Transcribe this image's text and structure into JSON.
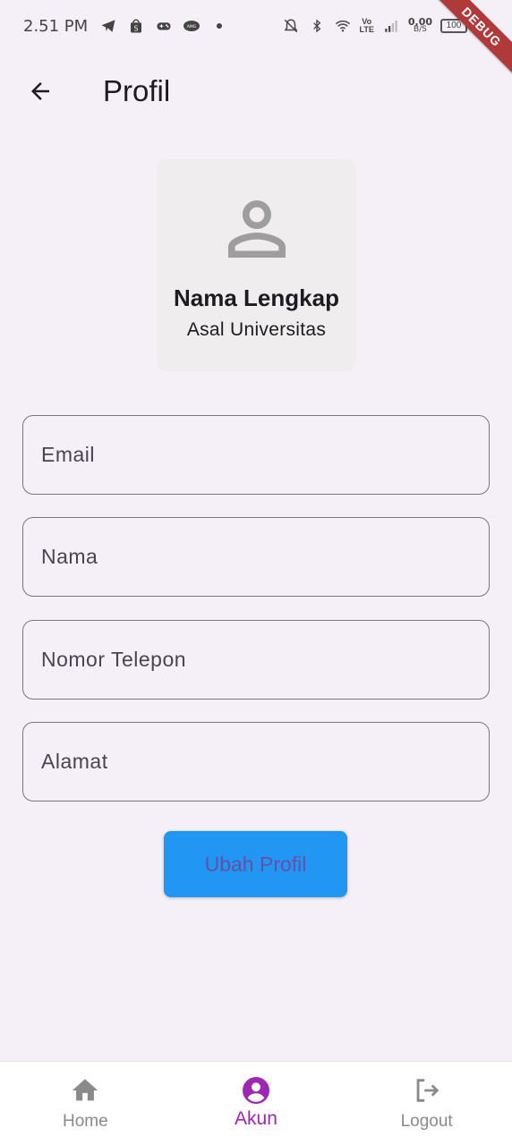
{
  "status_bar": {
    "time": "2.51 PM",
    "net_speed_value": "0,00",
    "net_speed_unit": "B/S",
    "lte_top": "Vo",
    "lte_bottom": "LTE",
    "battery": "100",
    "notification_icons": [
      "telegram-icon",
      "shopee-icon",
      "gamepad-icon",
      "app-icon",
      "dot-icon"
    ],
    "system_icons": [
      "mute-bell-icon",
      "bluetooth-icon",
      "wifi-icon",
      "volte-icon",
      "signal-icon",
      "net-speed",
      "battery-icon"
    ]
  },
  "debug_banner": "DEBUG",
  "app_bar": {
    "title": "Profil",
    "back_icon": "arrow-back-icon"
  },
  "profile": {
    "avatar_icon": "person-outline-icon",
    "name": "Nama Lengkap",
    "university": "Asal Universitas"
  },
  "form": {
    "email_placeholder": "Email",
    "nama_placeholder": "Nama",
    "phone_placeholder": "Nomor Telepon",
    "alamat_placeholder": "Alamat",
    "submit_label": "Ubah Profil"
  },
  "bottom_nav": {
    "items": [
      {
        "label": "Home",
        "icon": "home-icon",
        "active": false
      },
      {
        "label": "Akun",
        "icon": "account-circle-icon",
        "active": true
      },
      {
        "label": "Logout",
        "icon": "logout-icon",
        "active": false
      }
    ]
  },
  "colors": {
    "background": "#f5eff7",
    "button": "#2196f3",
    "button_text": "#6750a4",
    "nav_active": "#9c27b0",
    "nav_inactive": "#8a8a8a",
    "debug_ribbon": "#b03a3a"
  }
}
